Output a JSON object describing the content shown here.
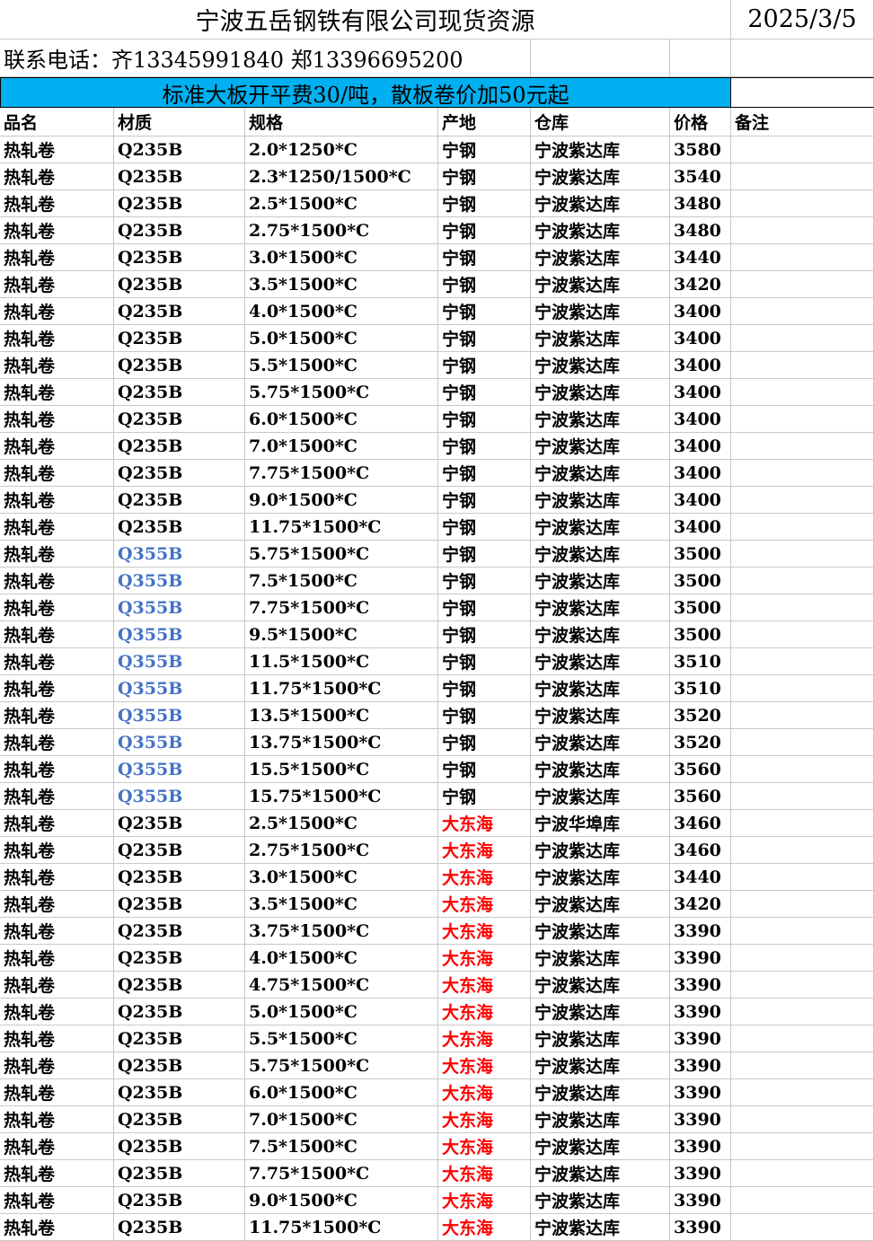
{
  "title": "宁波五岳钢铁有限公司现货资源",
  "date": "2025/3/5",
  "contact": "联系电话：齐13345991840  郑13396695200",
  "notice": "标准大板开平费30/吨，散板卷价加50元起",
  "columns": [
    "品名",
    "材质",
    "规格",
    "产地",
    "仓库",
    "价格",
    "备注"
  ],
  "colors": {
    "notice_bg": "#00b0f0",
    "q355b_text": "#4472c4",
    "dadonghai_text": "#ff0000"
  },
  "rows": [
    {
      "name": "热轧卷",
      "material": "Q235B",
      "spec": "2.0*1250*C",
      "origin": "宁钢",
      "warehouse": "宁波紫达库",
      "price": "3580",
      "note": ""
    },
    {
      "name": "热轧卷",
      "material": "Q235B",
      "spec": "2.3*1250/1500*C",
      "origin": "宁钢",
      "warehouse": "宁波紫达库",
      "price": "3540",
      "note": ""
    },
    {
      "name": "热轧卷",
      "material": "Q235B",
      "spec": "2.5*1500*C",
      "origin": "宁钢",
      "warehouse": "宁波紫达库",
      "price": "3480",
      "note": ""
    },
    {
      "name": "热轧卷",
      "material": "Q235B",
      "spec": "2.75*1500*C",
      "origin": "宁钢",
      "warehouse": "宁波紫达库",
      "price": "3480",
      "note": ""
    },
    {
      "name": "热轧卷",
      "material": "Q235B",
      "spec": "3.0*1500*C",
      "origin": "宁钢",
      "warehouse": "宁波紫达库",
      "price": "3440",
      "note": ""
    },
    {
      "name": "热轧卷",
      "material": "Q235B",
      "spec": "3.5*1500*C",
      "origin": "宁钢",
      "warehouse": "宁波紫达库",
      "price": "3420",
      "note": ""
    },
    {
      "name": "热轧卷",
      "material": "Q235B",
      "spec": "4.0*1500*C",
      "origin": "宁钢",
      "warehouse": "宁波紫达库",
      "price": "3400",
      "note": ""
    },
    {
      "name": "热轧卷",
      "material": "Q235B",
      "spec": "5.0*1500*C",
      "origin": "宁钢",
      "warehouse": "宁波紫达库",
      "price": "3400",
      "note": ""
    },
    {
      "name": "热轧卷",
      "material": "Q235B",
      "spec": "5.5*1500*C",
      "origin": "宁钢",
      "warehouse": "宁波紫达库",
      "price": "3400",
      "note": ""
    },
    {
      "name": "热轧卷",
      "material": "Q235B",
      "spec": "5.75*1500*C",
      "origin": "宁钢",
      "warehouse": "宁波紫达库",
      "price": "3400",
      "note": ""
    },
    {
      "name": "热轧卷",
      "material": "Q235B",
      "spec": "6.0*1500*C",
      "origin": "宁钢",
      "warehouse": "宁波紫达库",
      "price": "3400",
      "note": ""
    },
    {
      "name": "热轧卷",
      "material": "Q235B",
      "spec": "7.0*1500*C",
      "origin": "宁钢",
      "warehouse": "宁波紫达库",
      "price": "3400",
      "note": ""
    },
    {
      "name": "热轧卷",
      "material": "Q235B",
      "spec": "7.75*1500*C",
      "origin": "宁钢",
      "warehouse": "宁波紫达库",
      "price": "3400",
      "note": ""
    },
    {
      "name": "热轧卷",
      "material": "Q235B",
      "spec": "9.0*1500*C",
      "origin": "宁钢",
      "warehouse": "宁波紫达库",
      "price": "3400",
      "note": ""
    },
    {
      "name": "热轧卷",
      "material": "Q235B",
      "spec": "11.75*1500*C",
      "origin": "宁钢",
      "warehouse": "宁波紫达库",
      "price": "3400",
      "note": ""
    },
    {
      "name": "热轧卷",
      "material": "Q355B",
      "spec": "5.75*1500*C",
      "origin": "宁钢",
      "warehouse": "宁波紫达库",
      "price": "3500",
      "note": ""
    },
    {
      "name": "热轧卷",
      "material": "Q355B",
      "spec": "7.5*1500*C",
      "origin": "宁钢",
      "warehouse": "宁波紫达库",
      "price": "3500",
      "note": ""
    },
    {
      "name": "热轧卷",
      "material": "Q355B",
      "spec": "7.75*1500*C",
      "origin": "宁钢",
      "warehouse": "宁波紫达库",
      "price": "3500",
      "note": ""
    },
    {
      "name": "热轧卷",
      "material": "Q355B",
      "spec": "9.5*1500*C",
      "origin": "宁钢",
      "warehouse": "宁波紫达库",
      "price": "3500",
      "note": ""
    },
    {
      "name": "热轧卷",
      "material": "Q355B",
      "spec": "11.5*1500*C",
      "origin": "宁钢",
      "warehouse": "宁波紫达库",
      "price": "3510",
      "note": ""
    },
    {
      "name": "热轧卷",
      "material": "Q355B",
      "spec": "11.75*1500*C",
      "origin": "宁钢",
      "warehouse": "宁波紫达库",
      "price": "3510",
      "note": ""
    },
    {
      "name": "热轧卷",
      "material": "Q355B",
      "spec": "13.5*1500*C",
      "origin": "宁钢",
      "warehouse": "宁波紫达库",
      "price": "3520",
      "note": ""
    },
    {
      "name": "热轧卷",
      "material": "Q355B",
      "spec": "13.75*1500*C",
      "origin": "宁钢",
      "warehouse": "宁波紫达库",
      "price": "3520",
      "note": ""
    },
    {
      "name": "热轧卷",
      "material": "Q355B",
      "spec": "15.5*1500*C",
      "origin": "宁钢",
      "warehouse": "宁波紫达库",
      "price": "3560",
      "note": ""
    },
    {
      "name": "热轧卷",
      "material": "Q355B",
      "spec": "15.75*1500*C",
      "origin": "宁钢",
      "warehouse": "宁波紫达库",
      "price": "3560",
      "note": ""
    },
    {
      "name": "热轧卷",
      "material": "Q235B",
      "spec": "2.5*1500*C",
      "origin": "大东海",
      "warehouse": "宁波华埠库",
      "price": "3460",
      "note": ""
    },
    {
      "name": "热轧卷",
      "material": "Q235B",
      "spec": "2.75*1500*C",
      "origin": "大东海",
      "warehouse": "宁波紫达库",
      "price": "3460",
      "note": ""
    },
    {
      "name": "热轧卷",
      "material": "Q235B",
      "spec": "3.0*1500*C",
      "origin": "大东海",
      "warehouse": "宁波紫达库",
      "price": "3440",
      "note": ""
    },
    {
      "name": "热轧卷",
      "material": "Q235B",
      "spec": "3.5*1500*C",
      "origin": "大东海",
      "warehouse": "宁波紫达库",
      "price": "3420",
      "note": ""
    },
    {
      "name": "热轧卷",
      "material": "Q235B",
      "spec": "3.75*1500*C",
      "origin": "大东海",
      "warehouse": "宁波紫达库",
      "price": "3390",
      "note": ""
    },
    {
      "name": "热轧卷",
      "material": "Q235B",
      "spec": "4.0*1500*C",
      "origin": "大东海",
      "warehouse": "宁波紫达库",
      "price": "3390",
      "note": ""
    },
    {
      "name": "热轧卷",
      "material": "Q235B",
      "spec": "4.75*1500*C",
      "origin": "大东海",
      "warehouse": "宁波紫达库",
      "price": "3390",
      "note": ""
    },
    {
      "name": "热轧卷",
      "material": "Q235B",
      "spec": "5.0*1500*C",
      "origin": "大东海",
      "warehouse": "宁波紫达库",
      "price": "3390",
      "note": ""
    },
    {
      "name": "热轧卷",
      "material": "Q235B",
      "spec": "5.5*1500*C",
      "origin": "大东海",
      "warehouse": "宁波紫达库",
      "price": "3390",
      "note": ""
    },
    {
      "name": "热轧卷",
      "material": "Q235B",
      "spec": "5.75*1500*C",
      "origin": "大东海",
      "warehouse": "宁波紫达库",
      "price": "3390",
      "note": ""
    },
    {
      "name": "热轧卷",
      "material": "Q235B",
      "spec": "6.0*1500*C",
      "origin": "大东海",
      "warehouse": "宁波紫达库",
      "price": "3390",
      "note": ""
    },
    {
      "name": "热轧卷",
      "material": "Q235B",
      "spec": "7.0*1500*C",
      "origin": "大东海",
      "warehouse": "宁波紫达库",
      "price": "3390",
      "note": ""
    },
    {
      "name": "热轧卷",
      "material": "Q235B",
      "spec": "7.5*1500*C",
      "origin": "大东海",
      "warehouse": "宁波紫达库",
      "price": "3390",
      "note": ""
    },
    {
      "name": "热轧卷",
      "material": "Q235B",
      "spec": "7.75*1500*C",
      "origin": "大东海",
      "warehouse": "宁波紫达库",
      "price": "3390",
      "note": ""
    },
    {
      "name": "热轧卷",
      "material": "Q235B",
      "spec": "9.0*1500*C",
      "origin": "大东海",
      "warehouse": "宁波紫达库",
      "price": "3390",
      "note": ""
    },
    {
      "name": "热轧卷",
      "material": "Q235B",
      "spec": "11.75*1500*C",
      "origin": "大东海",
      "warehouse": "宁波紫达库",
      "price": "3390",
      "note": ""
    }
  ]
}
